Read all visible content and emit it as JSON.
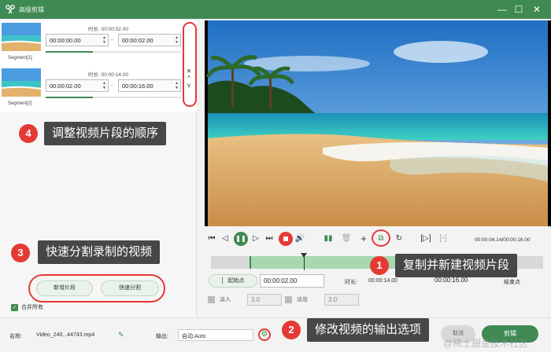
{
  "window": {
    "title": "高级剪辑",
    "controls": {
      "minimize": "—",
      "maximize": "☐",
      "close": "✕"
    }
  },
  "segments": [
    {
      "label": "Segment[1]",
      "duration_label": "时长:",
      "duration": "00:00:02.00",
      "start": "00:00:00.00",
      "end": "00:00:02.00",
      "sep": "~"
    },
    {
      "label": "Segment[2]",
      "duration_label": "时长:",
      "duration": "00:00:14.00",
      "start": "00:00:02.00",
      "end": "00:00:16.00",
      "sep": "~"
    }
  ],
  "segment_controls": {
    "delete": "✕",
    "move_up": "^",
    "move_down": "v"
  },
  "callouts": [
    {
      "num": "4",
      "text": "调整视频片段的顺序"
    },
    {
      "num": "3",
      "text": "快速分割录制的视频"
    },
    {
      "num": "1",
      "text": "复制并新建视频片段"
    },
    {
      "num": "2",
      "text": "修改视频的输出选项"
    }
  ],
  "left_buttons": {
    "new_segment": "新增片段",
    "quick_split": "快速分割"
  },
  "merge_all": {
    "label": "合并所有",
    "checked": true
  },
  "player": {
    "time_readout": "00:00:04.14/00:00:16.00",
    "selection_start_fraction": 0.116,
    "selection_end_fraction": 0.68,
    "playhead_fraction": 0.279
  },
  "trim": {
    "start_button": "起始点",
    "start_value": "00:00:02.00",
    "duration_label": "时长:",
    "duration_value": "00:00:14.00",
    "end_value": "00:00:16.00",
    "end_button": "结束点"
  },
  "fade": {
    "fade_in_label": "淡入",
    "fade_in_value": "3.0",
    "fade_out_label": "淡出",
    "fade_out_value": "3.0"
  },
  "bottom": {
    "name_label": "名称:",
    "name_value": "Video_240...44743.mp4",
    "output_label": "输出:",
    "output_value": "自动;Auto",
    "cut_button": "剪辑",
    "secondary_button": "取消",
    "watermark": "@稀土掘金技术社区"
  },
  "colors": {
    "accent": "#3f8a53",
    "annotation_red": "#e53935",
    "callout_bg": "#474747"
  }
}
